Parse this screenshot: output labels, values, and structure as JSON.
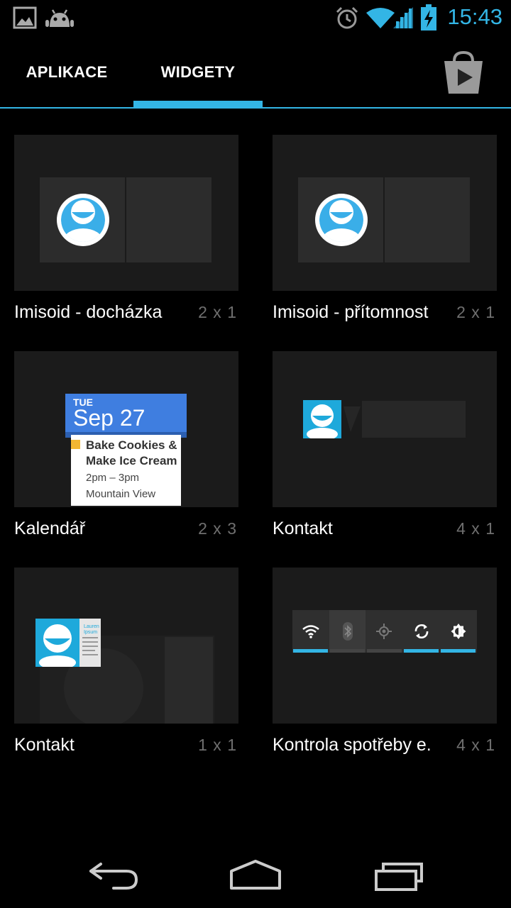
{
  "status_bar": {
    "time": "15:43",
    "icons": [
      "gallery-icon",
      "android-icon",
      "alarm-icon",
      "wifi-icon",
      "signal-icon",
      "battery-charging-icon"
    ]
  },
  "tabs": [
    {
      "label": "APLIKACE",
      "selected": false
    },
    {
      "label": "WIDGETY",
      "selected": true
    }
  ],
  "accent_color": "#33b5e5",
  "widgets": [
    {
      "title": "Imisoid - docházka",
      "size": "2 x 1"
    },
    {
      "title": "Imisoid - přítomnost",
      "size": "2 x 1"
    },
    {
      "title": "Kalendář",
      "size": "2 x 3"
    },
    {
      "title": "Kontakt",
      "size": "4 x 1"
    },
    {
      "title": "Kontakt",
      "size": "1 x 1"
    },
    {
      "title": "Kontrola spotřeby e.",
      "size": "4 x 1"
    }
  ],
  "calendar_preview": {
    "day_of_week": "TUE",
    "date": "Sep 27",
    "event_line1": "Bake Cookies &",
    "event_line2": "Make Ice Cream",
    "time": "2pm – 3pm",
    "location": "Mountain View"
  },
  "contact_card_text": {
    "name_line1": "Lauren",
    "name_line2": "Ipsum"
  },
  "power_control": {
    "buttons": [
      "wifi-icon",
      "bluetooth-icon",
      "gps-icon",
      "sync-icon",
      "brightness-icon"
    ],
    "active": [
      true,
      false,
      false,
      true,
      true
    ]
  }
}
